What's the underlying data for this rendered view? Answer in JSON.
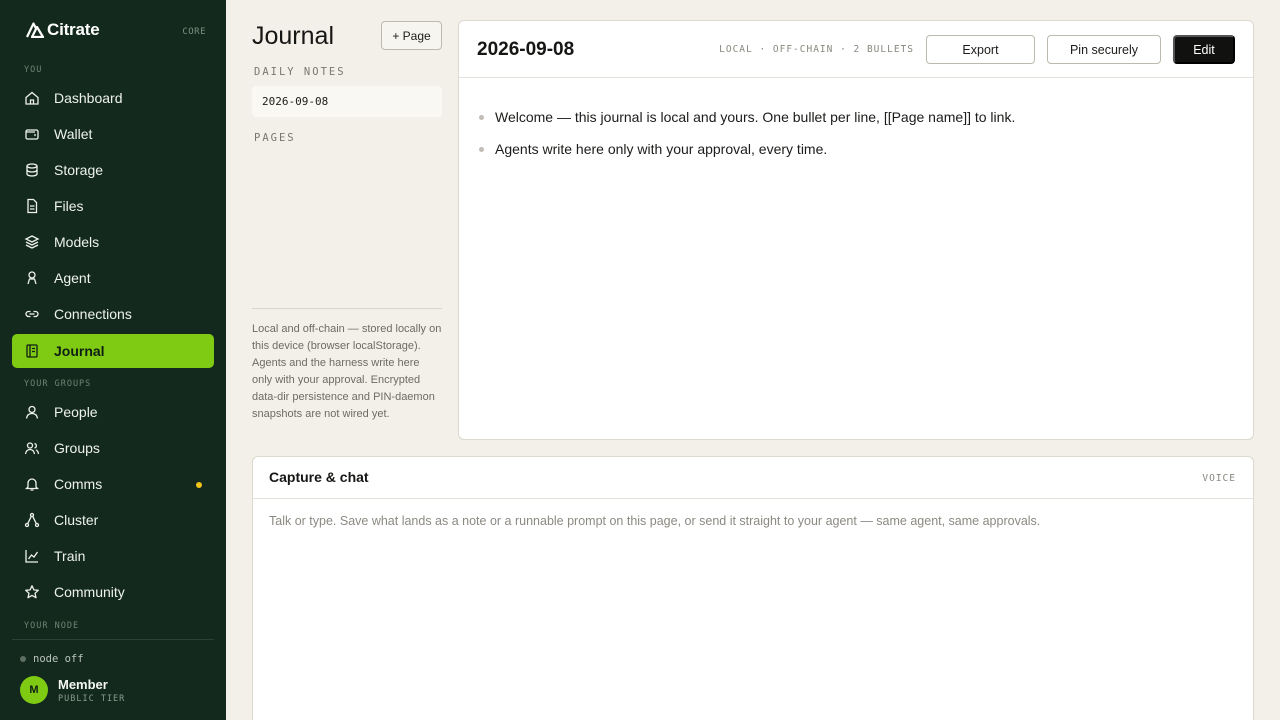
{
  "brand": {
    "name": "Citrate",
    "tag": "CORE"
  },
  "sidebar": {
    "section_you": "YOU",
    "section_groups": "YOUR GROUPS",
    "section_node": "YOUR NODE",
    "items": [
      {
        "label": "Dashboard",
        "icon": "home-icon"
      },
      {
        "label": "Wallet",
        "icon": "wallet-icon"
      },
      {
        "label": "Storage",
        "icon": "database-icon"
      },
      {
        "label": "Files",
        "icon": "file-icon"
      },
      {
        "label": "Models",
        "icon": "layers-icon"
      },
      {
        "label": "Agent",
        "icon": "agent-icon"
      },
      {
        "label": "Connections",
        "icon": "link-icon"
      },
      {
        "label": "Journal",
        "icon": "journal-icon",
        "active": true
      }
    ],
    "group_items": [
      {
        "label": "People",
        "icon": "person-icon"
      },
      {
        "label": "Groups",
        "icon": "users-icon"
      },
      {
        "label": "Comms",
        "icon": "bell-icon",
        "notification": true
      },
      {
        "label": "Cluster",
        "icon": "cluster-icon"
      },
      {
        "label": "Train",
        "icon": "chart-icon"
      },
      {
        "label": "Community",
        "icon": "star-icon"
      }
    ],
    "node_status": "node off",
    "user": {
      "initial": "M",
      "name": "Member",
      "tier": "PUBLIC TIER"
    }
  },
  "journal": {
    "title": "Journal",
    "add_page_label": "+ Page",
    "daily_notes_label": "DAILY NOTES",
    "daily_notes": [
      "2026-09-08"
    ],
    "pages_label": "PAGES",
    "footer_note": "Local and off-chain — stored locally on this device (browser localStorage). Agents and the harness write here only with your approval. Encrypted data-dir persistence and PIN-daemon snapshots are not wired yet."
  },
  "editor": {
    "date": "2026-09-08",
    "meta": "LOCAL · OFF-CHAIN · 2 BULLETS",
    "export_label": "Export",
    "pin_label": "Pin securely",
    "edit_label": "Edit",
    "bullets": [
      "Welcome — this journal is local and yours. One bullet per line, [[Page name]] to link.",
      "Agents write here only with your approval, every time."
    ]
  },
  "capture": {
    "title": "Capture & chat",
    "voice_label": "VOICE",
    "placeholder": "Talk or type. Save what lands as a note or a runnable prompt on this page, or send it straight to your agent — same agent, same approvals."
  },
  "colors": {
    "sidebar_bg": "#14291d",
    "accent": "#7fcb13",
    "notification": "#f0c419",
    "page_bg": "#f3f0e9"
  }
}
